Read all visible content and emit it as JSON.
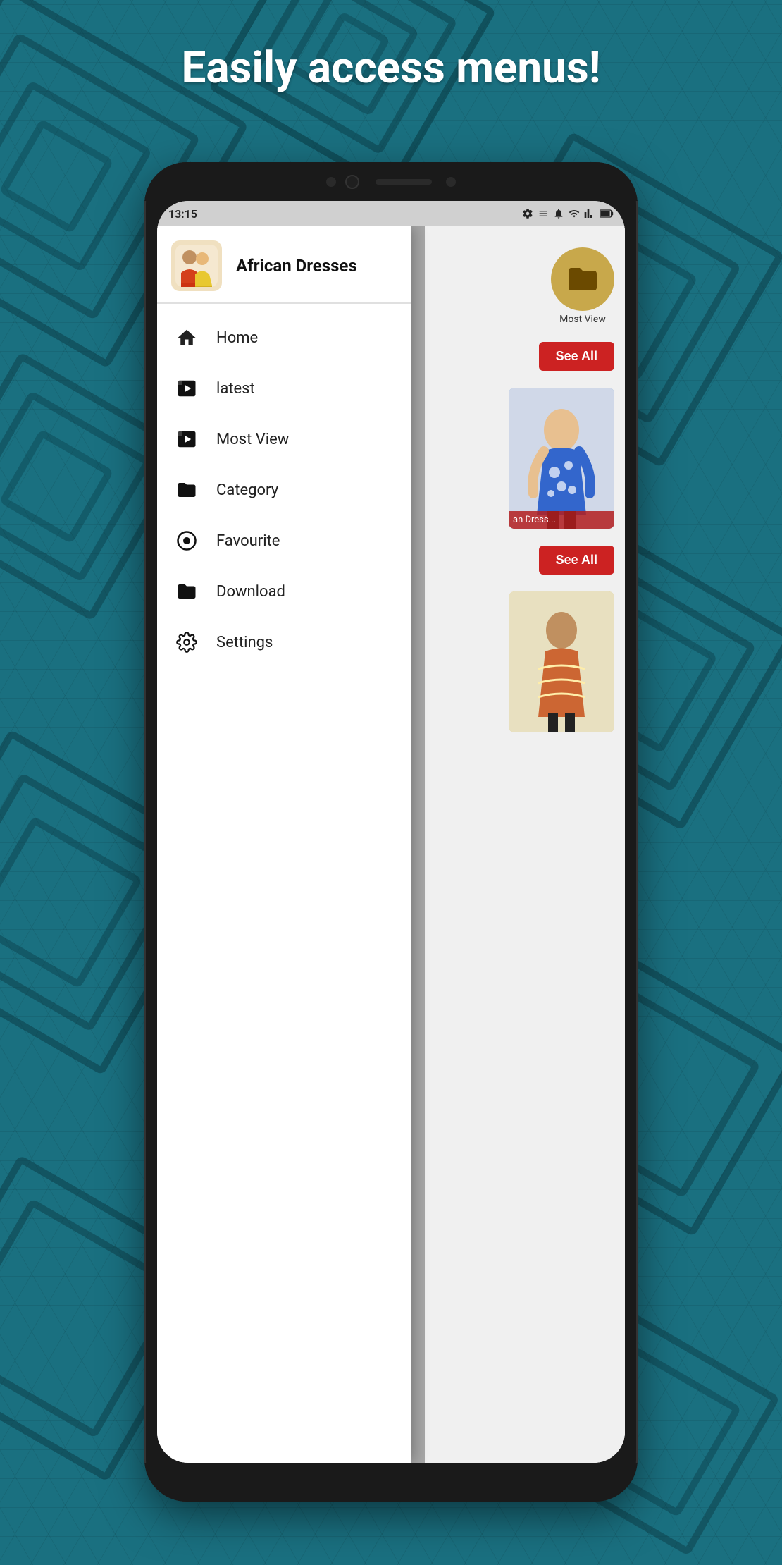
{
  "page": {
    "title": "Easily access menus!",
    "background_color": "#1a7080"
  },
  "status_bar": {
    "time": "13:15",
    "icons": [
      "gear",
      "media",
      "bell",
      "wifi",
      "signal",
      "battery"
    ]
  },
  "app": {
    "name": "African Dresses",
    "icon_emoji": "👗"
  },
  "drawer": {
    "items": [
      {
        "id": "home",
        "label": "Home",
        "icon": "home"
      },
      {
        "id": "latest",
        "label": "latest",
        "icon": "video-library"
      },
      {
        "id": "most-view",
        "label": "Most View",
        "icon": "video-library"
      },
      {
        "id": "category",
        "label": "Category",
        "icon": "folder"
      },
      {
        "id": "favourite",
        "label": "Favourite",
        "icon": "bookmark"
      },
      {
        "id": "download",
        "label": "Download",
        "icon": "folder"
      },
      {
        "id": "settings",
        "label": "Settings",
        "icon": "settings"
      }
    ]
  },
  "right_panel": {
    "category_label": "Most View",
    "see_all_1": "See All",
    "see_all_2": "See All",
    "dress_label": "an Dress..."
  }
}
